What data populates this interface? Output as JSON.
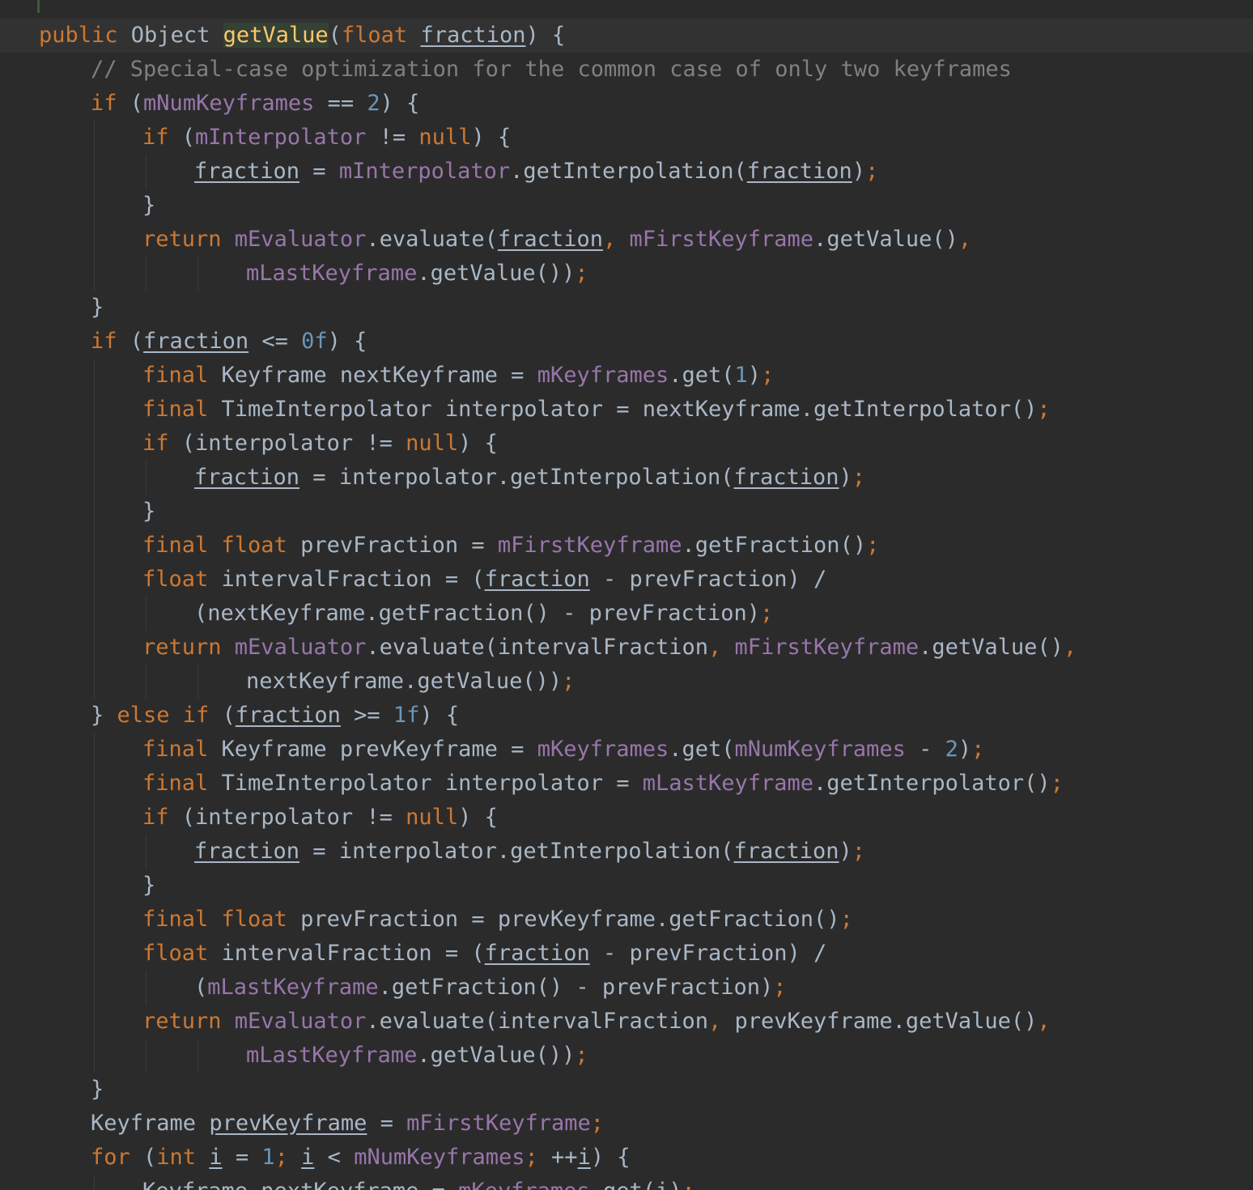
{
  "editor": {
    "language": "Java",
    "theme": "Darcula",
    "colors": {
      "background": "#2b2b2b",
      "current_line": "#323232",
      "keyword": "#cc7832",
      "method_declaration": "#ffc66d",
      "field": "#9876aa",
      "number": "#6897bb",
      "comment": "#808080",
      "plain": "#a9b7c6"
    },
    "lines": [
      {
        "indent": 0,
        "current": true,
        "tokens": [
          [
            "kw",
            "public "
          ],
          [
            "pl",
            "Object "
          ],
          [
            "fn-hl",
            "getValue"
          ],
          [
            "pl",
            "("
          ],
          [
            "kw",
            "float "
          ],
          [
            "ul",
            "fraction"
          ],
          [
            "pl",
            ") {"
          ]
        ]
      },
      {
        "indent": 1,
        "tokens": [
          [
            "cmt",
            "// Special-case optimization for the common case of only two keyframes"
          ]
        ]
      },
      {
        "indent": 1,
        "tokens": [
          [
            "kw",
            "if "
          ],
          [
            "pl",
            "("
          ],
          [
            "fld",
            "mNumKeyframes"
          ],
          [
            "pl",
            " == "
          ],
          [
            "num",
            "2"
          ],
          [
            "pl",
            ") {"
          ]
        ]
      },
      {
        "indent": 2,
        "tokens": [
          [
            "kw",
            "if "
          ],
          [
            "pl",
            "("
          ],
          [
            "fld",
            "mInterpolator"
          ],
          [
            "pl",
            " != "
          ],
          [
            "kw",
            "null"
          ],
          [
            "pl",
            ") {"
          ]
        ]
      },
      {
        "indent": 3,
        "tokens": [
          [
            "ul",
            "fraction"
          ],
          [
            "pl",
            " = "
          ],
          [
            "fld",
            "mInterpolator"
          ],
          [
            "pl",
            ".getInterpolation("
          ],
          [
            "ul",
            "fraction"
          ],
          [
            "pl",
            ")"
          ],
          [
            "semi",
            ";"
          ]
        ]
      },
      {
        "indent": 2,
        "tokens": [
          [
            "pl",
            "}"
          ]
        ]
      },
      {
        "indent": 2,
        "tokens": [
          [
            "kw",
            "return "
          ],
          [
            "fld",
            "mEvaluator"
          ],
          [
            "pl",
            ".evaluate("
          ],
          [
            "ul",
            "fraction"
          ],
          [
            "semi",
            ", "
          ],
          [
            "fld",
            "mFirstKeyframe"
          ],
          [
            "pl",
            ".getValue()"
          ],
          [
            "semi",
            ","
          ]
        ]
      },
      {
        "indent": 4,
        "tokens": [
          [
            "fld",
            "mLastKeyframe"
          ],
          [
            "pl",
            ".getValue())"
          ],
          [
            "semi",
            ";"
          ]
        ]
      },
      {
        "indent": 1,
        "tokens": [
          [
            "pl",
            "}"
          ]
        ]
      },
      {
        "indent": 1,
        "tokens": [
          [
            "kw",
            "if "
          ],
          [
            "pl",
            "("
          ],
          [
            "ul",
            "fraction"
          ],
          [
            "pl",
            " <= "
          ],
          [
            "num",
            "0f"
          ],
          [
            "pl",
            ") {"
          ]
        ]
      },
      {
        "indent": 2,
        "tokens": [
          [
            "kw",
            "final "
          ],
          [
            "pl",
            "Keyframe nextKeyframe = "
          ],
          [
            "fld",
            "mKeyframes"
          ],
          [
            "pl",
            ".get("
          ],
          [
            "num",
            "1"
          ],
          [
            "pl",
            ")"
          ],
          [
            "semi",
            ";"
          ]
        ]
      },
      {
        "indent": 2,
        "tokens": [
          [
            "kw",
            "final "
          ],
          [
            "pl",
            "TimeInterpolator interpolator = nextKeyframe.getInterpolator()"
          ],
          [
            "semi",
            ";"
          ]
        ]
      },
      {
        "indent": 2,
        "tokens": [
          [
            "kw",
            "if "
          ],
          [
            "pl",
            "(interpolator != "
          ],
          [
            "kw",
            "null"
          ],
          [
            "pl",
            ") {"
          ]
        ]
      },
      {
        "indent": 3,
        "tokens": [
          [
            "ul",
            "fraction"
          ],
          [
            "pl",
            " = interpolator.getInterpolation("
          ],
          [
            "ul",
            "fraction"
          ],
          [
            "pl",
            ")"
          ],
          [
            "semi",
            ";"
          ]
        ]
      },
      {
        "indent": 2,
        "tokens": [
          [
            "pl",
            "}"
          ]
        ]
      },
      {
        "indent": 2,
        "tokens": [
          [
            "kw",
            "final float "
          ],
          [
            "pl",
            "prevFraction = "
          ],
          [
            "fld",
            "mFirstKeyframe"
          ],
          [
            "pl",
            ".getFraction()"
          ],
          [
            "semi",
            ";"
          ]
        ]
      },
      {
        "indent": 2,
        "tokens": [
          [
            "kw",
            "float "
          ],
          [
            "pl",
            "intervalFraction = ("
          ],
          [
            "ul",
            "fraction"
          ],
          [
            "pl",
            " - prevFraction) /"
          ]
        ]
      },
      {
        "indent": 3,
        "tokens": [
          [
            "pl",
            "(nextKeyframe.getFraction() - prevFraction)"
          ],
          [
            "semi",
            ";"
          ]
        ]
      },
      {
        "indent": 2,
        "tokens": [
          [
            "kw",
            "return "
          ],
          [
            "fld",
            "mEvaluator"
          ],
          [
            "pl",
            ".evaluate(intervalFraction"
          ],
          [
            "semi",
            ", "
          ],
          [
            "fld",
            "mFirstKeyframe"
          ],
          [
            "pl",
            ".getValue()"
          ],
          [
            "semi",
            ","
          ]
        ]
      },
      {
        "indent": 4,
        "tokens": [
          [
            "pl",
            "nextKeyframe.getValue())"
          ],
          [
            "semi",
            ";"
          ]
        ]
      },
      {
        "indent": 1,
        "tokens": [
          [
            "pl",
            "} "
          ],
          [
            "kw",
            "else if "
          ],
          [
            "pl",
            "("
          ],
          [
            "ul",
            "fraction"
          ],
          [
            "pl",
            " >= "
          ],
          [
            "num",
            "1f"
          ],
          [
            "pl",
            ") {"
          ]
        ]
      },
      {
        "indent": 2,
        "tokens": [
          [
            "kw",
            "final "
          ],
          [
            "pl",
            "Keyframe prevKeyframe = "
          ],
          [
            "fld",
            "mKeyframes"
          ],
          [
            "pl",
            ".get("
          ],
          [
            "fld",
            "mNumKeyframes"
          ],
          [
            "pl",
            " - "
          ],
          [
            "num",
            "2"
          ],
          [
            "pl",
            ")"
          ],
          [
            "semi",
            ";"
          ]
        ]
      },
      {
        "indent": 2,
        "tokens": [
          [
            "kw",
            "final "
          ],
          [
            "pl",
            "TimeInterpolator interpolator = "
          ],
          [
            "fld",
            "mLastKeyframe"
          ],
          [
            "pl",
            ".getInterpolator()"
          ],
          [
            "semi",
            ";"
          ]
        ]
      },
      {
        "indent": 2,
        "tokens": [
          [
            "kw",
            "if "
          ],
          [
            "pl",
            "(interpolator != "
          ],
          [
            "kw",
            "null"
          ],
          [
            "pl",
            ") {"
          ]
        ]
      },
      {
        "indent": 3,
        "tokens": [
          [
            "ul",
            "fraction"
          ],
          [
            "pl",
            " = interpolator.getInterpolation("
          ],
          [
            "ul",
            "fraction"
          ],
          [
            "pl",
            ")"
          ],
          [
            "semi",
            ";"
          ]
        ]
      },
      {
        "indent": 2,
        "tokens": [
          [
            "pl",
            "}"
          ]
        ]
      },
      {
        "indent": 2,
        "tokens": [
          [
            "kw",
            "final float "
          ],
          [
            "pl",
            "prevFraction = prevKeyframe.getFraction()"
          ],
          [
            "semi",
            ";"
          ]
        ]
      },
      {
        "indent": 2,
        "tokens": [
          [
            "kw",
            "float "
          ],
          [
            "pl",
            "intervalFraction = ("
          ],
          [
            "ul",
            "fraction"
          ],
          [
            "pl",
            " - prevFraction) /"
          ]
        ]
      },
      {
        "indent": 3,
        "tokens": [
          [
            "pl",
            "("
          ],
          [
            "fld",
            "mLastKeyframe"
          ],
          [
            "pl",
            ".getFraction() - prevFraction)"
          ],
          [
            "semi",
            ";"
          ]
        ]
      },
      {
        "indent": 2,
        "tokens": [
          [
            "kw",
            "return "
          ],
          [
            "fld",
            "mEvaluator"
          ],
          [
            "pl",
            ".evaluate(intervalFraction"
          ],
          [
            "semi",
            ", "
          ],
          [
            "pl",
            "prevKeyframe.getValue()"
          ],
          [
            "semi",
            ","
          ]
        ]
      },
      {
        "indent": 4,
        "tokens": [
          [
            "fld",
            "mLastKeyframe"
          ],
          [
            "pl",
            ".getValue())"
          ],
          [
            "semi",
            ";"
          ]
        ]
      },
      {
        "indent": 1,
        "tokens": [
          [
            "pl",
            "}"
          ]
        ]
      },
      {
        "indent": 1,
        "tokens": [
          [
            "pl",
            "Keyframe "
          ],
          [
            "ul",
            "prevKeyframe"
          ],
          [
            "pl",
            " = "
          ],
          [
            "fld",
            "mFirstKeyframe"
          ],
          [
            "semi",
            ";"
          ]
        ]
      },
      {
        "indent": 1,
        "tokens": [
          [
            "kw",
            "for "
          ],
          [
            "pl",
            "("
          ],
          [
            "kw",
            "int "
          ],
          [
            "ul",
            "i"
          ],
          [
            "pl",
            " = "
          ],
          [
            "num",
            "1"
          ],
          [
            "semi",
            "; "
          ],
          [
            "ul",
            "i"
          ],
          [
            "pl",
            " < "
          ],
          [
            "fld",
            "mNumKeyframes"
          ],
          [
            "semi",
            "; "
          ],
          [
            "pl",
            "++"
          ],
          [
            "ul",
            "i"
          ],
          [
            "pl",
            ") {"
          ]
        ]
      },
      {
        "indent": 2,
        "tokens": [
          [
            "pl",
            "Keyframe nextKeyframe = "
          ],
          [
            "fld",
            "mKeyframes"
          ],
          [
            "pl",
            ".get("
          ],
          [
            "ul",
            "i"
          ],
          [
            "pl",
            ")"
          ],
          [
            "semi",
            ";"
          ]
        ]
      }
    ]
  }
}
